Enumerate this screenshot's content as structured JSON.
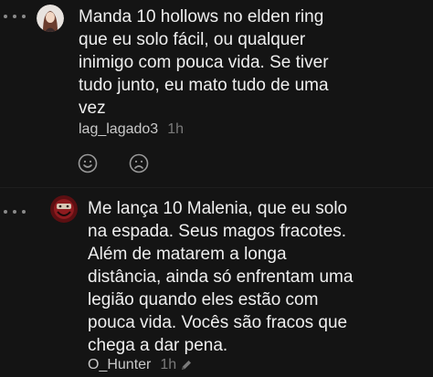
{
  "comments": [
    {
      "text": "Manda 10 hollows no elden ring\nque eu solo fácil, ou qualquer\ninimigo com pouca vida. Se tiver\ntudo junto, eu mato tudo de uma\nvez",
      "author": "lag_lagado3",
      "time": "1h",
      "reactions": [
        "smile-icon",
        "frown-icon"
      ]
    },
    {
      "text": "Me lança 10 Malenia, que eu solo\nna espada. Seus magos fracotes.\nAlém de matarem a longa\ndistância, ainda só enfrentam uma\nlegião quando eles estão com\npouca vida. Vocês são fracos que\nchega a dar pena.",
      "author": "O_Hunter",
      "time": "1h"
    }
  ],
  "colors": {
    "background": "#141414",
    "text": "#efefef",
    "muted": "#7a7a7a"
  }
}
